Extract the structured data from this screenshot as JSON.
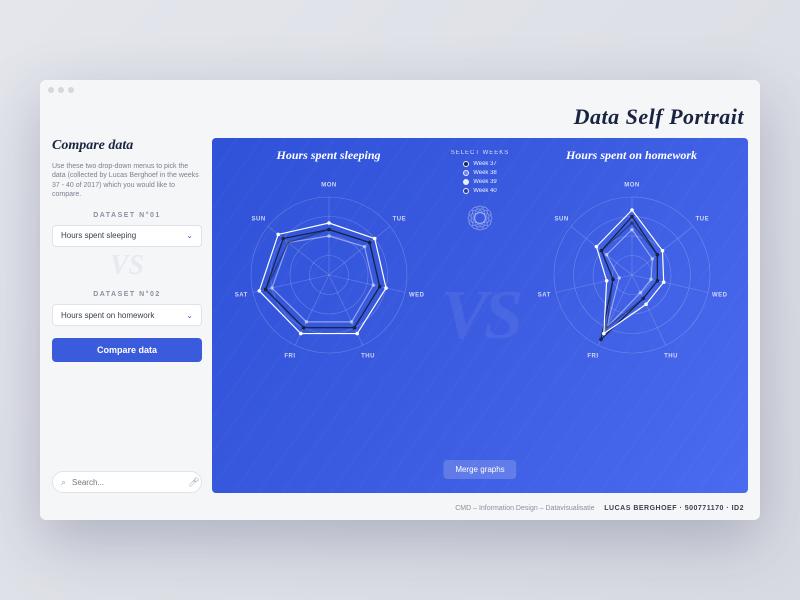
{
  "app": {
    "title": "Data Self Portrait"
  },
  "sidebar": {
    "title": "Compare data",
    "description": "Use these two drop-down menus to pick the data (collected by Lucas Berghoef in the weeks 37 - 40 of 2017) which you would like to compare.",
    "dataset1_label": "DATASET N°01",
    "dataset1_value": "Hours spent sleeping",
    "vs": "VS",
    "dataset2_label": "DATASET N°02",
    "dataset2_value": "Hours spent on homework",
    "compare_button": "Compare data",
    "search_placeholder": "Search..."
  },
  "charts": {
    "left_title": "Hours spent sleeping",
    "right_title": "Hours spent on homework",
    "legend_title": "SELECT WEEKS",
    "legend": [
      "Week 37",
      "Week 38",
      "Week 39",
      "Week 40"
    ],
    "merge_button": "Merge graphs",
    "vs_watermark": "VS"
  },
  "footer": {
    "course": "CMD – Information Design – Datavisualisatie",
    "author": "LUCAS BERGHOEF · 500771170 · ID2"
  },
  "chart_data": [
    {
      "type": "radar",
      "title": "Hours spent sleeping",
      "categories": [
        "MON",
        "TUE",
        "WED",
        "THU",
        "FRI",
        "SAT",
        "SUN"
      ],
      "range": [
        0,
        12
      ],
      "series": [
        {
          "name": "Week 37",
          "values": [
            7,
            8,
            8,
            9,
            9,
            10,
            9
          ]
        },
        {
          "name": "Week 38",
          "values": [
            6,
            7,
            7,
            8,
            8,
            9,
            8
          ]
        },
        {
          "name": "Week 39",
          "values": [
            8,
            9,
            9,
            10,
            10,
            11,
            10
          ]
        },
        {
          "name": "Week 40",
          "values": [
            7,
            8,
            8,
            9,
            9,
            10,
            8
          ]
        }
      ]
    },
    {
      "type": "radar",
      "title": "Hours spent on homework",
      "categories": [
        "MON",
        "TUE",
        "WED",
        "THU",
        "FRI",
        "SAT",
        "SUN"
      ],
      "range": [
        0,
        12
      ],
      "series": [
        {
          "name": "Week 37",
          "values": [
            9,
            5,
            4,
            4,
            11,
            3,
            6
          ]
        },
        {
          "name": "Week 38",
          "values": [
            7,
            4,
            3,
            3,
            9,
            2,
            5
          ]
        },
        {
          "name": "Week 39",
          "values": [
            10,
            6,
            5,
            5,
            10,
            4,
            7
          ]
        },
        {
          "name": "Week 40",
          "values": [
            8,
            5,
            4,
            4,
            9,
            3,
            6
          ]
        }
      ]
    }
  ]
}
